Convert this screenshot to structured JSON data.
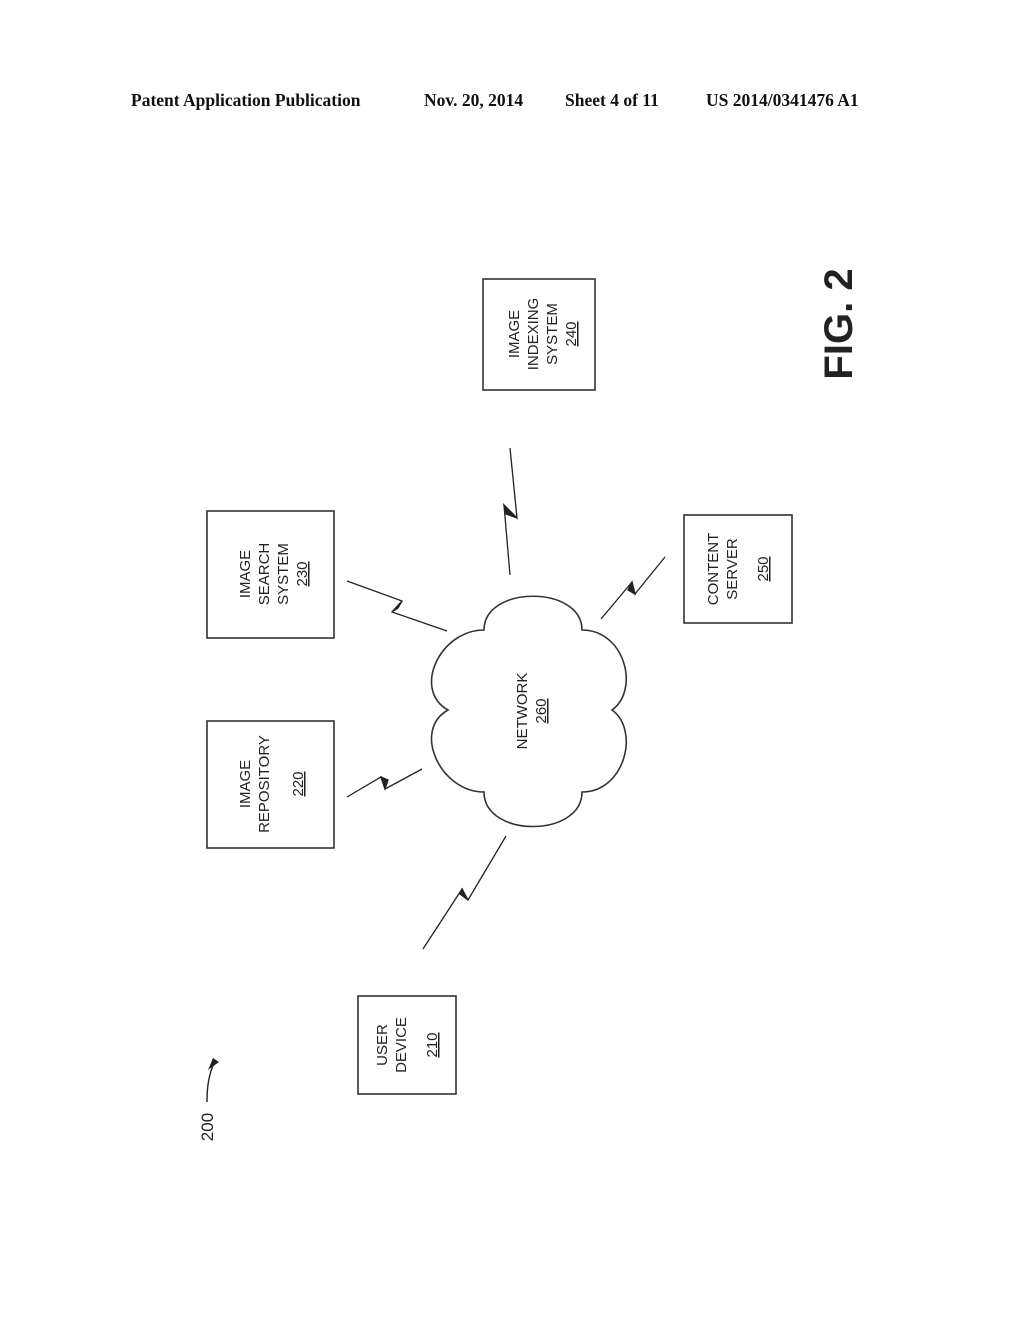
{
  "header": {
    "publication": "Patent Application Publication",
    "date": "Nov. 20, 2014",
    "sheet": "Sheet 4 of 11",
    "number": "US 2014/0341476 A1"
  },
  "figure": {
    "label": "FIG. 2",
    "ref": "200",
    "nodes": [
      {
        "id": "user-device",
        "lines": [
          "USER",
          "DEVICE"
        ],
        "ref": "210"
      },
      {
        "id": "image-repository",
        "lines": [
          "IMAGE",
          "REPOSITORY"
        ],
        "ref": "220"
      },
      {
        "id": "image-search-system",
        "lines": [
          "IMAGE",
          "SEARCH",
          "SYSTEM"
        ],
        "ref": "230"
      },
      {
        "id": "image-indexing-system",
        "lines": [
          "IMAGE",
          "INDEXING",
          "SYSTEM"
        ],
        "ref": "240"
      },
      {
        "id": "content-server",
        "lines": [
          "CONTENT",
          "SERVER"
        ],
        "ref": "250"
      },
      {
        "id": "network",
        "lines": [
          "NETWORK"
        ],
        "ref": "260"
      }
    ],
    "connections": [
      {
        "from": "user-device",
        "to": "network",
        "type": "wireless"
      },
      {
        "from": "image-repository",
        "to": "network",
        "type": "wireless"
      },
      {
        "from": "image-search-system",
        "to": "network",
        "type": "wireless"
      },
      {
        "from": "image-indexing-system",
        "to": "network",
        "type": "wireless"
      },
      {
        "from": "content-server",
        "to": "network",
        "type": "wireless"
      }
    ]
  }
}
